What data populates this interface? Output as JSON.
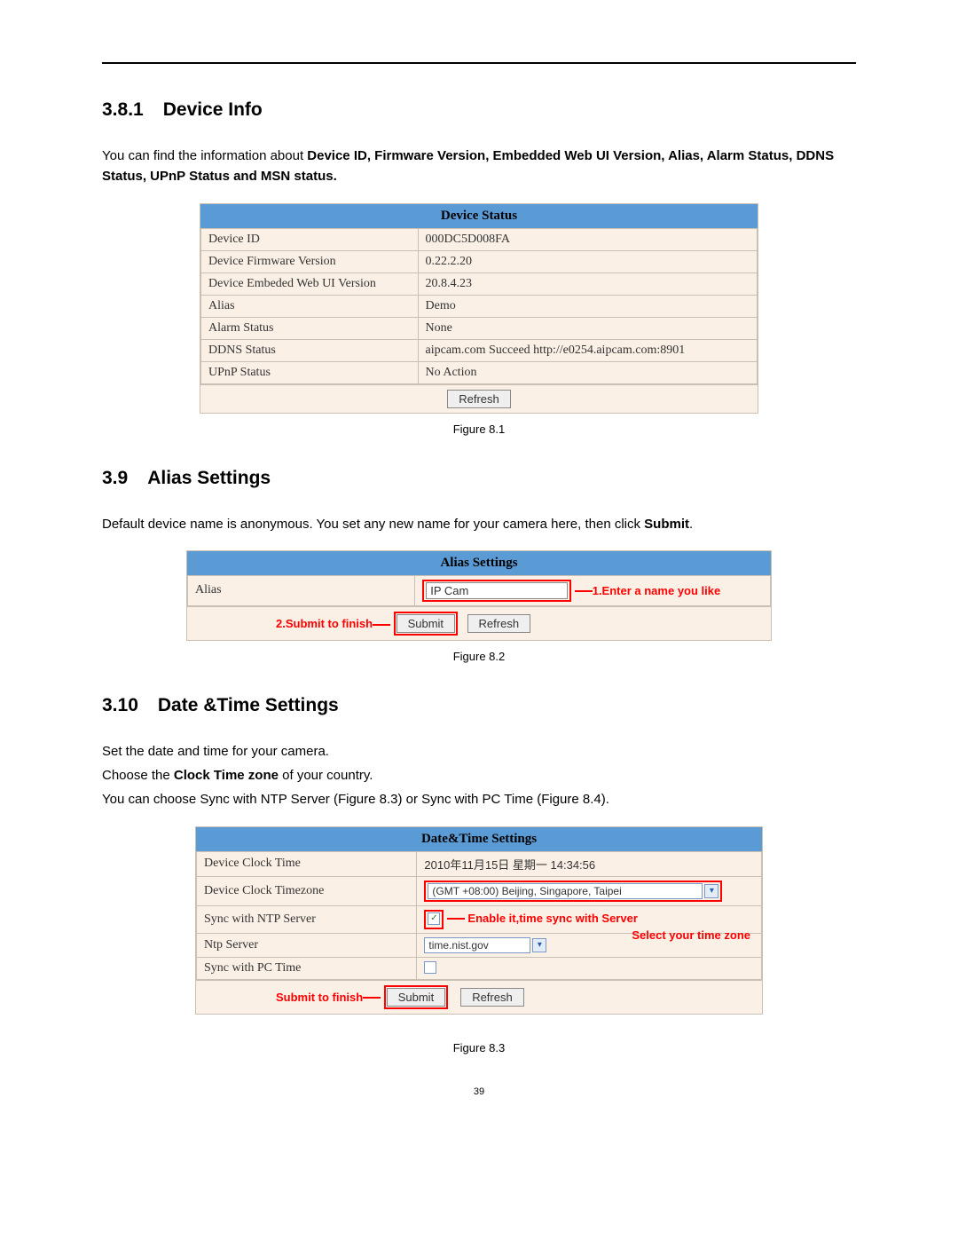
{
  "sections": {
    "s1": {
      "num": "3.8.1",
      "title": "Device Info"
    },
    "s2": {
      "num": "3.9",
      "title": "Alias Settings"
    },
    "s3": {
      "num": "3.10",
      "title": "Date &Time Settings"
    }
  },
  "intro1a": "You can find the information about ",
  "intro1b": "Device ID, Firmware Version, Embedded Web UI Version, Alias, Alarm Status, DDNS Status, UPnP Status and MSN status.",
  "device_status": {
    "header": "Device Status",
    "rows": [
      {
        "k": "Device ID",
        "v": "000DC5D008FA"
      },
      {
        "k": "Device Firmware Version",
        "v": "0.22.2.20"
      },
      {
        "k": "Device Embeded Web UI Version",
        "v": "20.8.4.23"
      },
      {
        "k": "Alias",
        "v": "Demo"
      },
      {
        "k": "Alarm Status",
        "v": "None"
      },
      {
        "k": "DDNS Status",
        "v": "aipcam.com  Succeed  http://e0254.aipcam.com:8901"
      },
      {
        "k": "UPnP Status",
        "v": "No Action"
      }
    ],
    "refresh": "Refresh"
  },
  "fig1": "Figure 8.1",
  "alias_intro_a": "Default device name is anonymous. You set any new name for your camera here, then click ",
  "alias_intro_b": "Submit",
  "alias_intro_c": ".",
  "alias_panel": {
    "header": "Alias Settings",
    "label": "Alias",
    "input_value": "IP Cam",
    "anno1": "1.Enter a name you like",
    "anno2": "2.Submit to finish",
    "submit": "Submit",
    "refresh": "Refresh"
  },
  "fig2": "Figure 8.2",
  "dt_intro1": "Set the date and time for your camera.",
  "dt_intro2a": "Choose the ",
  "dt_intro2b": "Clock Time zone",
  "dt_intro2c": " of your country.",
  "dt_intro3": "You can choose Sync with NTP Server (Figure 8.3) or Sync with PC Time (Figure 8.4).",
  "dt_panel": {
    "header": "Date&Time Settings",
    "rows": {
      "clock_time": {
        "k": "Device Clock Time",
        "v": "2010年11月15日 星期一 14:34:56"
      },
      "timezone": {
        "k": "Device Clock Timezone",
        "v": "(GMT +08:00) Beijing, Singapore, Taipei"
      },
      "ntp_sync": {
        "k": "Sync with NTP Server"
      },
      "ntp_server": {
        "k": "Ntp Server",
        "v": "time.nist.gov"
      },
      "pc_sync": {
        "k": "Sync with PC Time"
      }
    },
    "anno_enable": "Enable it,time sync with Server",
    "anno_selecttz": "Select your time zone",
    "anno_submit": "Submit to finish",
    "submit": "Submit",
    "refresh": "Refresh"
  },
  "fig3": "Figure 8.3",
  "page_num": "39"
}
